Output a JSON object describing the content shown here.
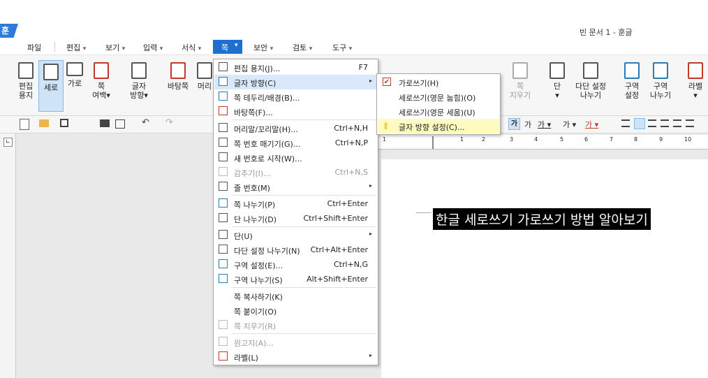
{
  "app": {
    "logo_text": "훈",
    "document_title": "빈 문서 1 - 훈글"
  },
  "menubar": {
    "items": [
      {
        "label": "파일",
        "arrow": ""
      },
      {
        "label": "편집",
        "arrow": "▾"
      },
      {
        "label": "보기",
        "arrow": "▾"
      },
      {
        "label": "입력",
        "arrow": "▾"
      },
      {
        "label": "서식",
        "arrow": "▾"
      },
      {
        "label": "쪽",
        "arrow": "▾"
      },
      {
        "label": "보안",
        "arrow": "▾"
      },
      {
        "label": "검토",
        "arrow": "▾"
      },
      {
        "label": "도구",
        "arrow": "▾"
      }
    ]
  },
  "ribbon": {
    "buttons": [
      {
        "line1": "편집",
        "line2": "용지"
      },
      {
        "line1": "세로",
        "line2": ""
      },
      {
        "line1": "가로",
        "line2": ""
      },
      {
        "line1": "쪽",
        "line2": "여백▾"
      },
      {
        "line1": "글자",
        "line2": "방향▾"
      },
      {
        "line1": "바탕쪽",
        "line2": ""
      },
      {
        "line1": "머리",
        "line2": ""
      },
      {
        "line1": "쪽",
        "line2": "지우기"
      },
      {
        "line1": "단",
        "line2": "▾"
      },
      {
        "line1": "다단 설정",
        "line2": "나누기"
      },
      {
        "line1": "구역",
        "line2": "설정"
      },
      {
        "line1": "구역",
        "line2": "나누기"
      },
      {
        "line1": "라벨",
        "line2": "▾"
      }
    ]
  },
  "dropdown": {
    "items": [
      {
        "label": "편집 용지(J)...",
        "shortcut": "F7",
        "disabled": false,
        "submenu": false
      },
      {
        "label": "글자 방향(C)",
        "shortcut": "",
        "disabled": false,
        "submenu": true
      },
      {
        "label": "쪽 테두리/배경(B)...",
        "shortcut": "",
        "disabled": false,
        "submenu": false
      },
      {
        "label": "바탕쪽(F)...",
        "shortcut": "",
        "disabled": false,
        "submenu": false
      },
      {
        "label": "머리말/꼬리말(H)...",
        "shortcut": "Ctrl+N,H",
        "disabled": false,
        "submenu": false
      },
      {
        "label": "쪽 번호 매기기(G)...",
        "shortcut": "Ctrl+N,P",
        "disabled": false,
        "submenu": false
      },
      {
        "label": "새 번호로 시작(W)...",
        "shortcut": "",
        "disabled": false,
        "submenu": false
      },
      {
        "label": "감추기(I)...",
        "shortcut": "Ctrl+N,S",
        "disabled": true,
        "submenu": false
      },
      {
        "label": "줄 번호(M)",
        "shortcut": "",
        "disabled": false,
        "submenu": true
      },
      {
        "label": "쪽 나누기(P)",
        "shortcut": "Ctrl+Enter",
        "disabled": false,
        "submenu": false
      },
      {
        "label": "단 나누기(D)",
        "shortcut": "Ctrl+Shift+Enter",
        "disabled": false,
        "submenu": false
      },
      {
        "label": "단(U)",
        "shortcut": "",
        "disabled": false,
        "submenu": true
      },
      {
        "label": "다단 설정 나누기(N)",
        "shortcut": "Ctrl+Alt+Enter",
        "disabled": false,
        "submenu": false
      },
      {
        "label": "구역 설정(E)...",
        "shortcut": "Ctrl+N,G",
        "disabled": false,
        "submenu": false
      },
      {
        "label": "구역 나누기(S)",
        "shortcut": "Alt+Shift+Enter",
        "disabled": false,
        "submenu": false
      },
      {
        "label": "쪽 복사하기(K)",
        "shortcut": "",
        "disabled": false,
        "submenu": false
      },
      {
        "label": "쪽 붙이기(O)",
        "shortcut": "",
        "disabled": false,
        "submenu": false
      },
      {
        "label": "쪽 지우기(R)",
        "shortcut": "",
        "disabled": true,
        "submenu": false
      },
      {
        "label": "원고지(A)...",
        "shortcut": "",
        "disabled": true,
        "submenu": false
      },
      {
        "label": "라벨(L)",
        "shortcut": "",
        "disabled": false,
        "submenu": true
      }
    ]
  },
  "submenu": {
    "items": [
      {
        "label": "가로쓰기(H)",
        "checked": true
      },
      {
        "label": "세로쓰기(영문 눕힘)(O)",
        "checked": false
      },
      {
        "label": "세로쓰기(영문 세움)(U)",
        "checked": false
      },
      {
        "label": "글자 방향 설정(C)...",
        "checked": false
      }
    ]
  },
  "toolbar": {
    "char_style_label": "가",
    "font_labels": [
      "가",
      "가",
      "가",
      "가"
    ]
  },
  "ruler": {
    "marks": [
      "1",
      "1",
      "2",
      "3",
      "4",
      "5",
      "6",
      "7",
      "8",
      "9",
      "10"
    ]
  },
  "document": {
    "heading": "한글 세로쓰기 가로쓰기 방법 알아보기"
  },
  "colors": {
    "accent": "#1f6fd1",
    "highlight": "#fdfbc0",
    "menu_hover": "#d9e8fb"
  }
}
